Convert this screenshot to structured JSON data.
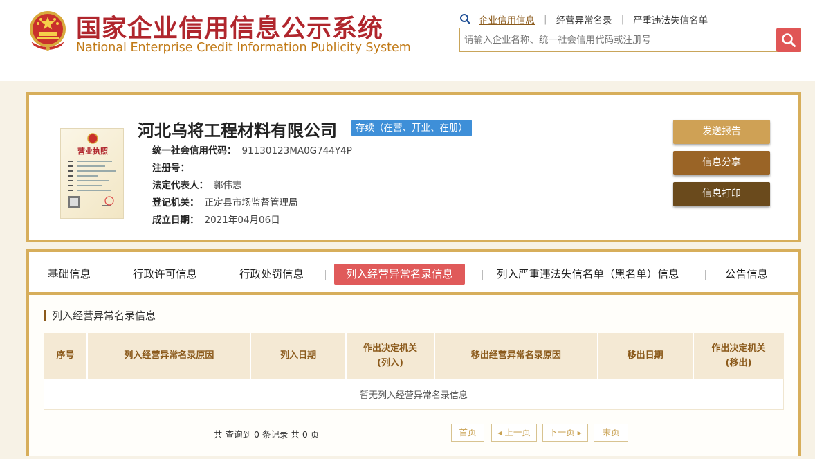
{
  "header": {
    "title_cn": "国家企业信用信息公示系统",
    "title_en": "National Enterprise Credit Information Publicity System",
    "links": [
      "企业信用信息",
      "经营异常名录",
      "严重违法失信名单"
    ],
    "search_placeholder": "请输入企业名称、统一社会信用代码或注册号"
  },
  "company": {
    "name": "河北乌将工程材料有限公司",
    "status": "存续（在营、开业、在册）",
    "license_title": "营业执照",
    "fields": [
      {
        "label": "统一社会信用代码：",
        "value": "91130123MA0G744Y4P"
      },
      {
        "label": "注册号：",
        "value": ""
      },
      {
        "label": "法定代表人：",
        "value": "郭伟志"
      },
      {
        "label": "登记机关：",
        "value": "正定县市场监督管理局"
      },
      {
        "label": "成立日期：",
        "value": "2021年04月06日"
      }
    ],
    "actions": {
      "report": "发送报告",
      "share": "信息分享",
      "print": "信息打印"
    }
  },
  "tabs": [
    "基础信息",
    "行政许可信息",
    "行政处罚信息",
    "列入经营异常名录信息",
    "列入严重违法失信名单（黑名单）信息",
    "公告信息"
  ],
  "active_tab": "列入经营异常名录信息",
  "section": {
    "title": "列入经营异常名录信息",
    "columns": [
      "序号",
      "列入经营异常名录原因",
      "列入日期",
      "作出决定机关\n(列入)",
      "移出经营异常名录原因",
      "移出日期",
      "作出决定机关\n(移出)"
    ],
    "empty_text": "暂无列入经营异常名录信息"
  },
  "pager": {
    "info": "共 查询到 0 条记录 共 0 页",
    "first": "首页",
    "prev": "上一页",
    "next": "下一页",
    "last": "末页"
  },
  "colors": {
    "brand_red": "#b0262d",
    "gold": "#d7ae5b",
    "active_tab": "#e05a5a",
    "status_blue": "#3e8fd8"
  }
}
